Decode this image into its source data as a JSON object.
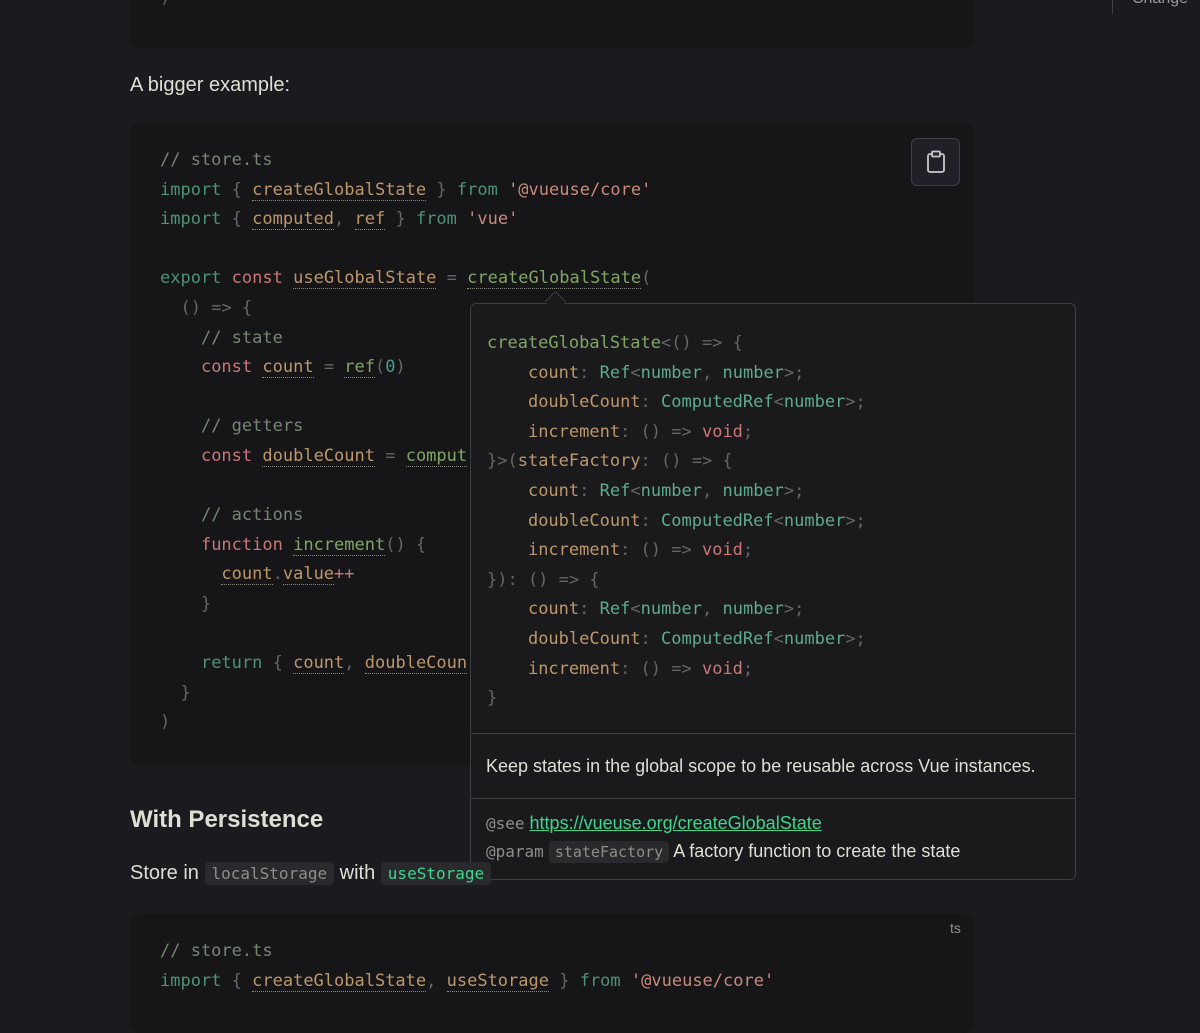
{
  "top_right": {
    "text": "Change"
  },
  "code1_tail": {
    "line": ")"
  },
  "section1": {
    "para": "A bigger example:"
  },
  "code2": {
    "comment": "// store.ts",
    "import1_kw": "import",
    "import1_name": "createGlobalState",
    "from": "from",
    "import1_src": "'@vueuse/core'",
    "import2_name1": "computed",
    "import2_name2": "ref",
    "import2_src": "'vue'",
    "export": "export",
    "const": "const",
    "useGlobalState": "useGlobalState",
    "createGlobalState": "createGlobalState",
    "state_comment": "// state",
    "count": "count",
    "ref": "ref",
    "zero": "0",
    "getters_comment": "// getters",
    "doubleCount": "doubleCount",
    "comput": "comput",
    "actions_comment": "// actions",
    "function": "function",
    "increment": "increment",
    "value": "value",
    "plusplus": "++",
    "return": "return",
    "doubleCoun": "doubleCoun"
  },
  "copy_button": {
    "icon": "clipboard-icon"
  },
  "popup": {
    "sig_name": "createGlobalState",
    "count": "count",
    "doubleCount": "doubleCount",
    "increment": "increment",
    "Ref": "Ref",
    "ComputedRef": "ComputedRef",
    "number": "number",
    "void": "void",
    "stateFactory": "stateFactory",
    "description": "Keep states in the global scope to be reusable across Vue instances.",
    "see_tag": "@see",
    "see_link": "https://vueuse.org/createGlobalState",
    "param_tag": "@param",
    "param_name": "stateFactory",
    "param_desc": "A factory function to create the state"
  },
  "section2": {
    "heading": "With Persistence",
    "para_prefix": "Store in",
    "code_local": "localStorage",
    "para_with": "with",
    "code_use": "useStorage"
  },
  "code3": {
    "lang": "ts",
    "comment": "// store.ts",
    "import_kw": "import",
    "name1": "createGlobalState",
    "name2": "useStorage",
    "from": "from",
    "src": "'@vueuse/core'"
  }
}
